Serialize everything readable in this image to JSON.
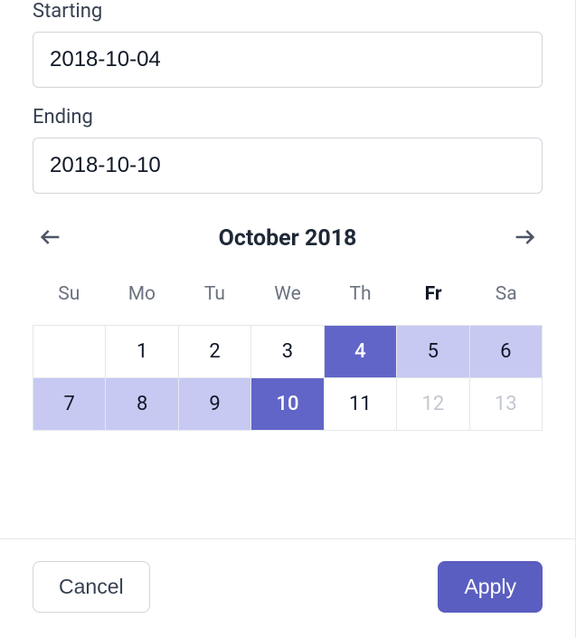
{
  "fields": {
    "starting": {
      "label": "Starting",
      "value": "2018-10-04"
    },
    "ending": {
      "label": "Ending",
      "value": "2018-10-10"
    }
  },
  "calendar": {
    "month_title": "October 2018",
    "weekdays": [
      "Su",
      "Mo",
      "Tu",
      "We",
      "Th",
      "Fr",
      "Sa"
    ],
    "today_weekday_index": 5,
    "leading_blanks": 1,
    "days": [
      {
        "n": 1,
        "state": "normal"
      },
      {
        "n": 2,
        "state": "normal"
      },
      {
        "n": 3,
        "state": "normal"
      },
      {
        "n": 4,
        "state": "range-start"
      },
      {
        "n": 5,
        "state": "in-range"
      },
      {
        "n": 6,
        "state": "in-range"
      },
      {
        "n": 7,
        "state": "in-range"
      },
      {
        "n": 8,
        "state": "in-range"
      },
      {
        "n": 9,
        "state": "in-range"
      },
      {
        "n": 10,
        "state": "range-end"
      },
      {
        "n": 11,
        "state": "normal"
      },
      {
        "n": 12,
        "state": "disabled"
      },
      {
        "n": 13,
        "state": "disabled"
      }
    ]
  },
  "buttons": {
    "cancel": "Cancel",
    "apply": "Apply"
  },
  "colors": {
    "accent": "#5a5ec0",
    "range_fill": "#c7c9f2"
  }
}
